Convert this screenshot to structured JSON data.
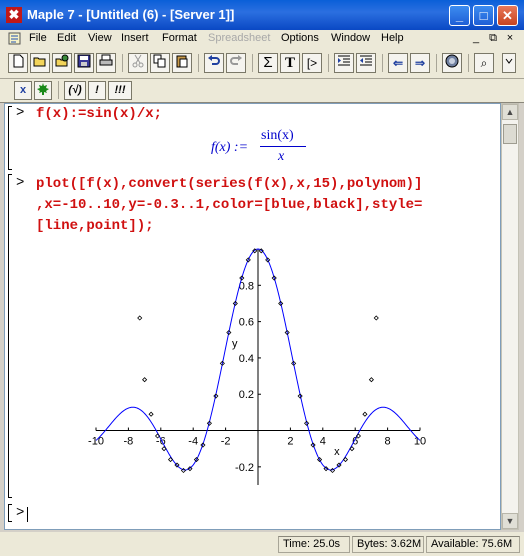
{
  "window": {
    "app_icon": "maple-leaf-icon",
    "title": "Maple 7  - [Untitled (6) - [Server 1]]",
    "minimize": "_",
    "maximize": "□",
    "close": "✕"
  },
  "menu": {
    "items": [
      {
        "label": "File"
      },
      {
        "label": "Edit"
      },
      {
        "label": "View"
      },
      {
        "label": "Insert"
      },
      {
        "label": "Format"
      },
      {
        "label": "Spreadsheet",
        "disabled": true
      },
      {
        "label": "Options"
      },
      {
        "label": "Window"
      },
      {
        "label": "Help"
      }
    ],
    "mdi_min": "_",
    "mdi_restore": "⧉",
    "mdi_close": "×"
  },
  "toolbar": {
    "sum": "Σ",
    "text": "T",
    "prompt": "[>",
    "stop": "⊖",
    "zoom": "⌕",
    "back": "⇐",
    "forward": "⇒"
  },
  "toolbar2": {
    "x_btn": "x",
    "check_btn": "(√)",
    "exec_btn": "!",
    "exec_all_btn": "!!!"
  },
  "worksheet": {
    "prompt": ">",
    "cmd1": "f(x):=sin(x)/x;",
    "output1": {
      "lhs": "f(x) :=",
      "numerator": "sin(x)",
      "denominator": "x"
    },
    "cmd2": "plot([f(x),convert(series(f(x),x,15),polynom)]\n,x=-10..10,y=-0.3..1,color=[blue,black],style=\n[line,point]);",
    "empty_prompt": ">"
  },
  "chart_data": {
    "type": "line",
    "title": "",
    "xlabel": "x",
    "ylabel": "y",
    "xlim": [
      -10,
      10
    ],
    "ylim": [
      -0.3,
      1
    ],
    "xticks": [
      -10,
      -8,
      -6,
      -4,
      -2,
      2,
      4,
      6,
      8,
      10
    ],
    "yticks": [
      -0.2,
      0.2,
      0.4,
      0.6,
      0.8
    ],
    "series": [
      {
        "function": "sin(x)/x",
        "color": "#0000ff",
        "style": "line"
      },
      {
        "function": "taylor-series-order-15",
        "color": "#000000",
        "style": "point",
        "points": [
          [
            -7.3,
            0.62
          ],
          [
            -7.0,
            0.28
          ],
          [
            -6.6,
            0.09
          ],
          [
            -6.2,
            -0.03
          ],
          [
            -5.8,
            -0.1
          ],
          [
            -5.4,
            -0.16
          ],
          [
            -5.0,
            -0.19
          ],
          [
            -4.6,
            -0.22
          ],
          [
            -4.2,
            -0.21
          ],
          [
            -3.8,
            -0.16
          ],
          [
            -3.4,
            -0.08
          ],
          [
            -3.0,
            0.04
          ],
          [
            -2.6,
            0.19
          ],
          [
            -2.2,
            0.37
          ],
          [
            -1.8,
            0.54
          ],
          [
            -1.4,
            0.7
          ],
          [
            -1.0,
            0.84
          ],
          [
            -0.6,
            0.94
          ],
          [
            -0.2,
            0.99
          ],
          [
            0.2,
            0.99
          ],
          [
            0.6,
            0.94
          ],
          [
            1.0,
            0.84
          ],
          [
            1.4,
            0.7
          ],
          [
            1.8,
            0.54
          ],
          [
            2.2,
            0.37
          ],
          [
            2.6,
            0.19
          ],
          [
            3.0,
            0.04
          ],
          [
            3.4,
            -0.08
          ],
          [
            3.8,
            -0.16
          ],
          [
            4.2,
            -0.21
          ],
          [
            4.6,
            -0.22
          ],
          [
            5.0,
            -0.19
          ],
          [
            5.4,
            -0.16
          ],
          [
            5.8,
            -0.1
          ],
          [
            6.2,
            -0.03
          ],
          [
            6.6,
            0.09
          ],
          [
            7.0,
            0.28
          ],
          [
            7.3,
            0.62
          ]
        ]
      }
    ]
  },
  "statusbar": {
    "time": "Time:  25.0s",
    "bytes": "Bytes: 3.62M",
    "available": "Available: 75.6M"
  },
  "colors": {
    "titlebar": "#0a48c4",
    "command": "#d01010",
    "output": "#0000cc"
  }
}
